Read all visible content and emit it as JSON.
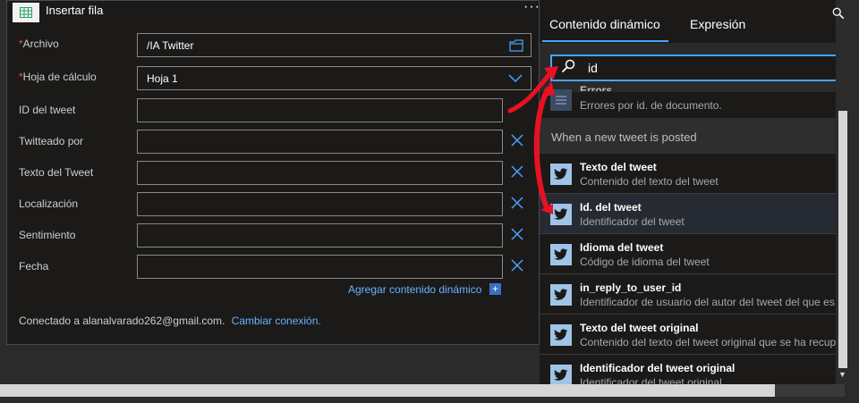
{
  "card": {
    "title": "Insertar fila",
    "more": "···",
    "required_mark": "*",
    "fields": {
      "archivo": {
        "label": "Archivo",
        "value": "/IA Twitter"
      },
      "hoja": {
        "label": "Hoja de cálculo",
        "value": "Hoja 1"
      },
      "id_tweet": {
        "label": "ID del tweet",
        "value": ""
      },
      "twitteado": {
        "label": "Twitteado por",
        "value": ""
      },
      "texto": {
        "label": "Texto del Tweet",
        "value": ""
      },
      "localizacion": {
        "label": "Localización",
        "value": ""
      },
      "sentimiento": {
        "label": "Sentimiento",
        "value": ""
      },
      "fecha": {
        "label": "Fecha",
        "value": ""
      }
    },
    "add_dynamic": "Agregar contenido dinámico",
    "connected_text": "Conectado a alanalvarado262@gmail.com.",
    "change_connection": "Cambiar conexión."
  },
  "panel": {
    "tabs": [
      "Contenido dinámico",
      "Expresión"
    ],
    "search_value": "id",
    "partial_item": {
      "title": "Errors",
      "subtitle": "Errores por id. de documento."
    },
    "section_title": "When a new tweet is posted",
    "items": [
      {
        "title": "Texto del tweet",
        "subtitle": "Contenido del texto del tweet"
      },
      {
        "title": "Id. del tweet",
        "subtitle": "Identificador del tweet"
      },
      {
        "title": "Idioma del tweet",
        "subtitle": "Código de idioma del tweet"
      },
      {
        "title": "in_reply_to_user_id",
        "subtitle": "Identificador de usuario del autor del tweet del que es"
      },
      {
        "title": "Texto del tweet original",
        "subtitle": "Contenido del texto del tweet original que se ha recup"
      },
      {
        "title": "Identificador del tweet original",
        "subtitle": "Identificador del tweet original"
      }
    ]
  },
  "colors": {
    "accent": "#4aa3ff",
    "link": "#66b3ff",
    "twitter": "#1da1f2",
    "annotation": "#e81123"
  },
  "icons": [
    "spreadsheet-icon",
    "folder-icon",
    "chevron-down-icon",
    "close-icon",
    "plus-icon",
    "search-icon",
    "twitter-icon",
    "document-icon"
  ]
}
